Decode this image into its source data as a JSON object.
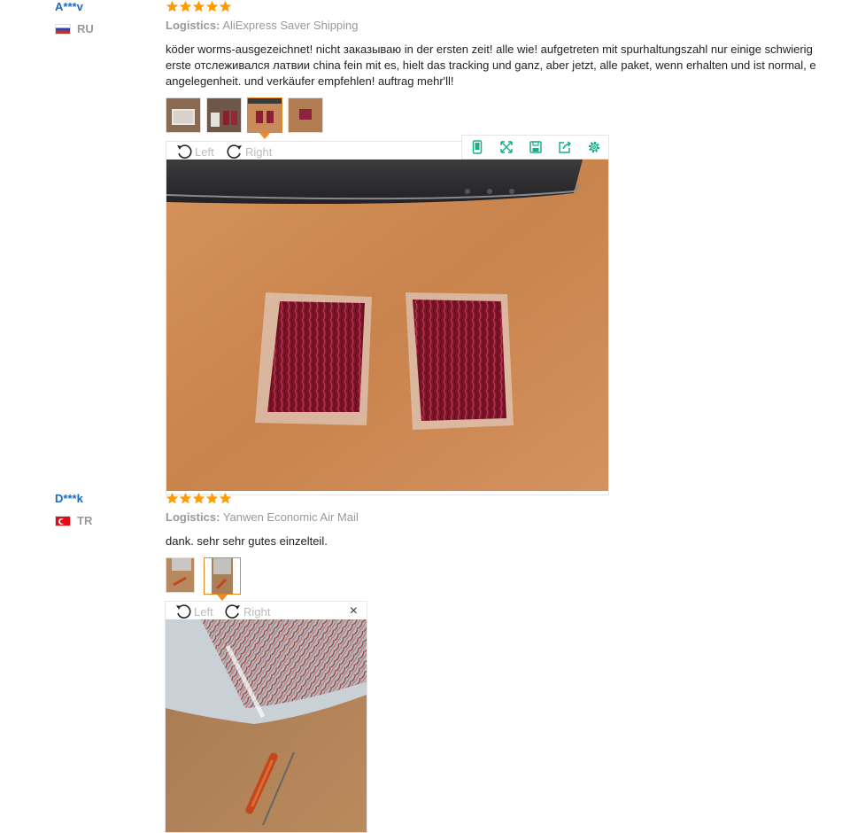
{
  "reviews": [
    {
      "user": "A***v",
      "country": "RU",
      "stars": 5,
      "logistics_label": "Logistics:",
      "logistics_value": "AliExpress Saver Shipping",
      "text_lines": [
        "köder worms-ausgezeichnet! nicht заказываю in der ersten zeit! alle wie! aufgetreten mit spurhaltungszahl nur einige schwierig",
        "erste отслеживался латвии china fein mit es, hielt das tracking und ganz, aber jetzt, alle paket, wenn erhalten und ist normal, e",
        "angelegenheit. und verkäufer empfehlen! auftrag mehr'll!"
      ],
      "thumbnail_count": 4,
      "active_thumbnail": 3
    },
    {
      "user": "D***k",
      "country": "TR",
      "stars": 5,
      "logistics_label": "Logistics:",
      "logistics_value": "Yanwen Economic Air Mail",
      "text_lines": [
        "dank. sehr sehr gutes einzelteil."
      ],
      "thumbnail_count": 2,
      "active_thumbnail": 2
    }
  ],
  "viewer": {
    "rotate_left_label": "Left",
    "rotate_right_label": "Right",
    "close_glyph": "×",
    "tool_icons": [
      "phone-icon",
      "fullscreen-icon",
      "save-icon",
      "share-icon",
      "settings-icon"
    ]
  },
  "colors": {
    "username": "#1a6bc4",
    "star": "#ff9a00",
    "active_thumb_border": "#e08a1e",
    "tool_icon": "#1aae8a"
  }
}
